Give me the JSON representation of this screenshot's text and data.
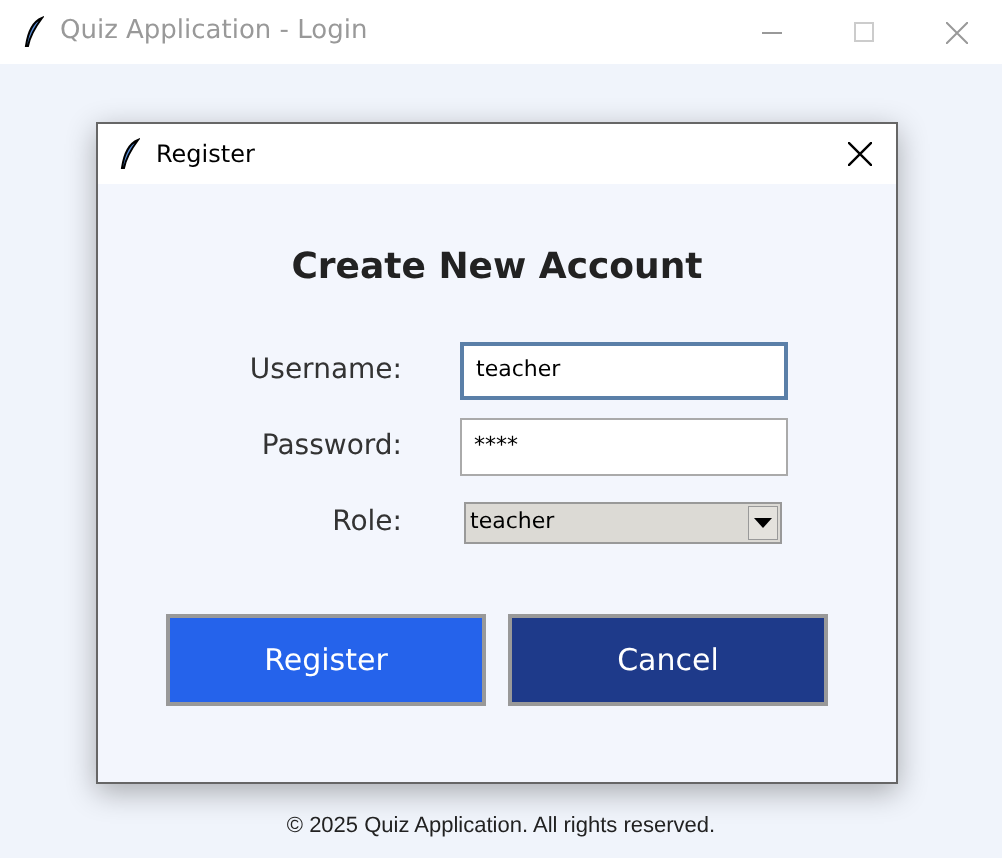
{
  "window": {
    "title": "Quiz Application - Login",
    "active": false
  },
  "dialog": {
    "title": "Register",
    "heading": "Create New Account",
    "fields": [
      {
        "kind": "text",
        "label": "Username:",
        "value": "teacher",
        "focused": true
      },
      {
        "kind": "text",
        "label": "Password:",
        "value": "****",
        "focused": false
      },
      {
        "kind": "combo",
        "label": "Role:",
        "value": "teacher",
        "focused": false
      }
    ],
    "buttons": [
      {
        "label": "Register",
        "kind": "primary"
      },
      {
        "label": "Cancel",
        "kind": "secondary"
      }
    ]
  },
  "footer": "© 2025 Quiz Application. All rights reserved."
}
